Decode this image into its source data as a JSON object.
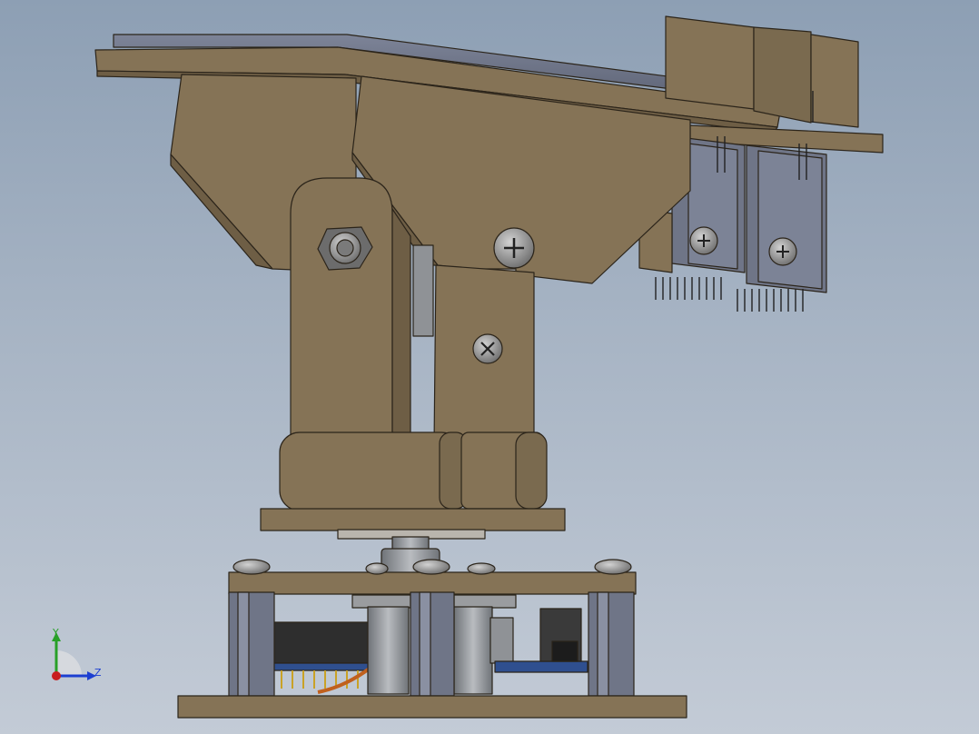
{
  "viewport": {
    "background_top": "#8d9fb4",
    "background_bottom": "#c3cbd6"
  },
  "colors": {
    "part_face": "#857356",
    "part_edge": "#2b241a",
    "part_light": "#a08c6a",
    "part_dark": "#6e5e45",
    "panel": "#6f7587",
    "metal_grey": "#8f9296",
    "pcb_blue": "#2f4f8f",
    "board_dark": "#2e2e2e",
    "pins_gold": "#c9a227",
    "wire_orange": "#c0601e"
  },
  "triad": {
    "icon": "coordinate-triad-icon",
    "y_label": "Y",
    "z_label": "Z",
    "y_color": "#28a028",
    "z_color": "#1d3fd1",
    "origin_color": "#c81e1e"
  }
}
